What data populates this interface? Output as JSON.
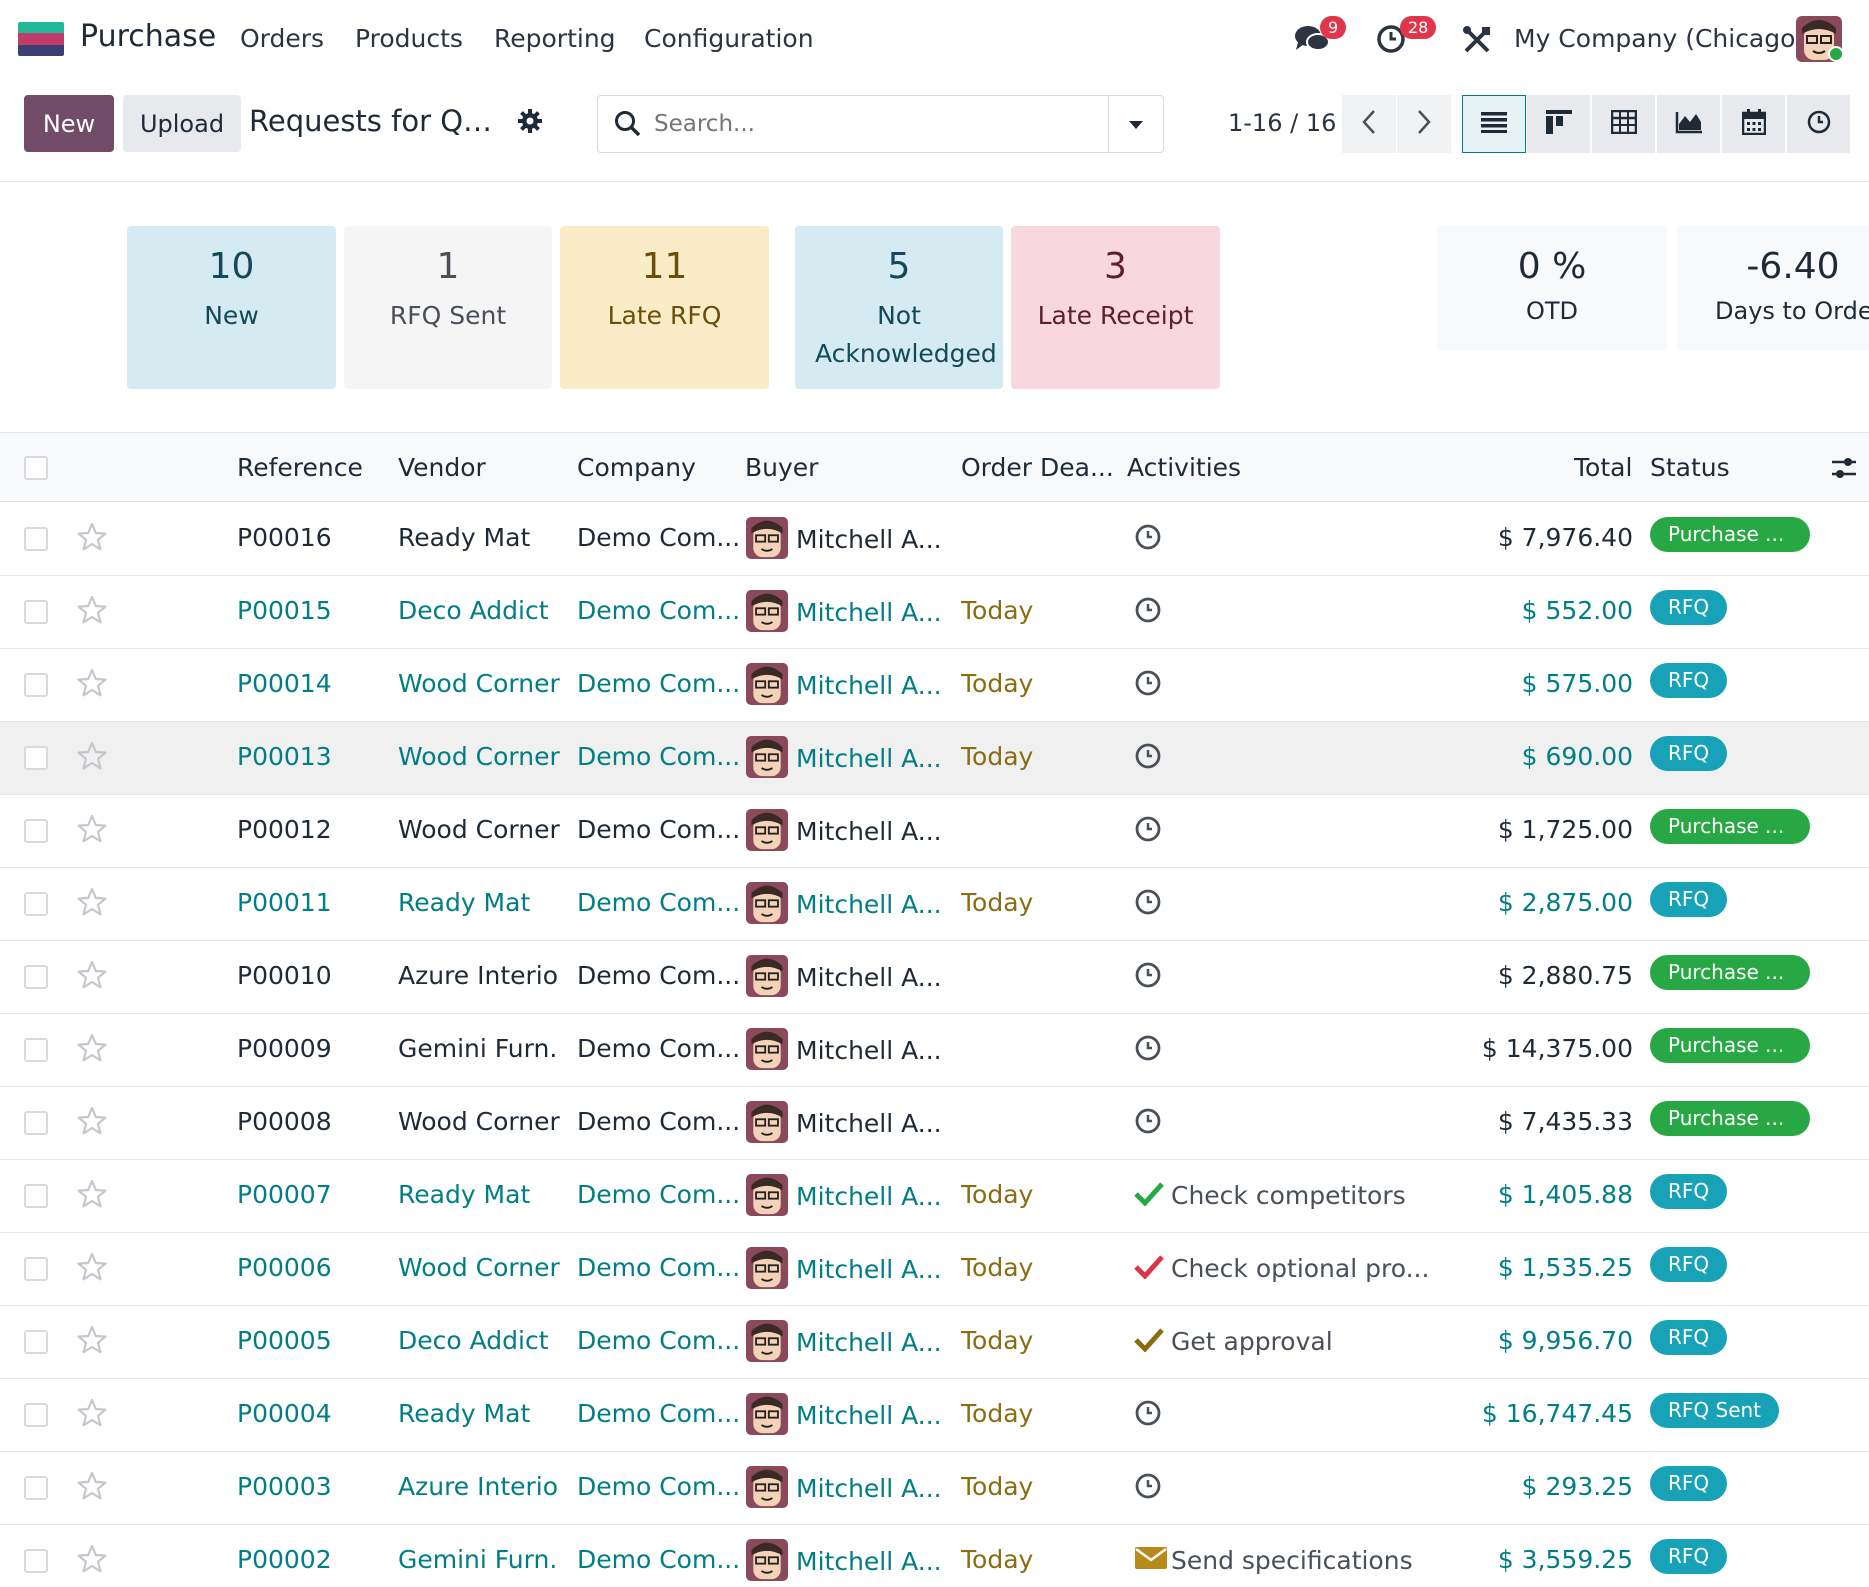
{
  "navbar": {
    "app_name": "Purchase",
    "menu": [
      "Orders",
      "Products",
      "Reporting",
      "Configuration"
    ],
    "messages_count": "9",
    "activities_count": "28",
    "company": "My Company (Chicago)"
  },
  "control": {
    "new_label": "New",
    "upload_label": "Upload",
    "breadcrumb": "Requests for Quotation",
    "search_placeholder": "Search...",
    "pager": "1-16 / 16"
  },
  "cards": [
    {
      "num": "10",
      "label": "New"
    },
    {
      "num": "1",
      "label": "RFQ Sent"
    },
    {
      "num": "11",
      "label": "Late RFQ"
    },
    {
      "num": "5",
      "label": "Not Acknowledged"
    },
    {
      "num": "3",
      "label": "Late Receipt"
    }
  ],
  "kpis": [
    {
      "num": "0 %",
      "label": "OTD"
    },
    {
      "num": "-6.40",
      "label": "Days to Order"
    }
  ],
  "table": {
    "headers": {
      "reference": "Reference",
      "vendor": "Vendor",
      "company": "Company",
      "buyer": "Buyer",
      "deadline": "Order Dea...",
      "activities": "Activities",
      "total": "Total",
      "status": "Status"
    },
    "rows": [
      {
        "ref": "P00016",
        "vendor": "Ready Mat",
        "company": "Demo Com...",
        "buyer": "Mitchell A...",
        "deadline": "",
        "activity": "",
        "activity_icon": "clock-icon",
        "total": "$ 7,976.40",
        "status": "Purchase ...",
        "status_kind": "purchase"
      },
      {
        "ref": "P00015",
        "vendor": "Deco Addict",
        "company": "Demo Com...",
        "buyer": "Mitchell A...",
        "deadline": "Today",
        "activity": "",
        "activity_icon": "clock-icon",
        "total": "$ 552.00",
        "status": "RFQ",
        "status_kind": "rfq"
      },
      {
        "ref": "P00014",
        "vendor": "Wood Corner",
        "company": "Demo Com...",
        "buyer": "Mitchell A...",
        "deadline": "Today",
        "activity": "",
        "activity_icon": "clock-icon",
        "total": "$ 575.00",
        "status": "RFQ",
        "status_kind": "rfq"
      },
      {
        "ref": "P00013",
        "vendor": "Wood Corner",
        "company": "Demo Com...",
        "buyer": "Mitchell A...",
        "deadline": "Today",
        "activity": "",
        "activity_icon": "clock-icon",
        "total": "$ 690.00",
        "status": "RFQ",
        "status_kind": "rfq"
      },
      {
        "ref": "P00012",
        "vendor": "Wood Corner",
        "company": "Demo Com...",
        "buyer": "Mitchell A...",
        "deadline": "",
        "activity": "",
        "activity_icon": "clock-icon",
        "total": "$ 1,725.00",
        "status": "Purchase ...",
        "status_kind": "purchase"
      },
      {
        "ref": "P00011",
        "vendor": "Ready Mat",
        "company": "Demo Com...",
        "buyer": "Mitchell A...",
        "deadline": "Today",
        "activity": "",
        "activity_icon": "clock-icon",
        "total": "$ 2,875.00",
        "status": "RFQ",
        "status_kind": "rfq"
      },
      {
        "ref": "P00010",
        "vendor": "Azure Interior",
        "company": "Demo Com...",
        "buyer": "Mitchell A...",
        "deadline": "",
        "activity": "",
        "activity_icon": "clock-icon",
        "total": "$ 2,880.75",
        "status": "Purchase ...",
        "status_kind": "purchase"
      },
      {
        "ref": "P00009",
        "vendor": "Gemini Furn...",
        "company": "Demo Com...",
        "buyer": "Mitchell A...",
        "deadline": "",
        "activity": "",
        "activity_icon": "clock-icon",
        "total": "$ 14,375.00",
        "status": "Purchase ...",
        "status_kind": "purchase"
      },
      {
        "ref": "P00008",
        "vendor": "Wood Corner",
        "company": "Demo Com...",
        "buyer": "Mitchell A...",
        "deadline": "",
        "activity": "",
        "activity_icon": "clock-icon",
        "total": "$ 7,435.33",
        "status": "Purchase ...",
        "status_kind": "purchase"
      },
      {
        "ref": "P00007",
        "vendor": "Ready Mat",
        "company": "Demo Com...",
        "buyer": "Mitchell A...",
        "deadline": "Today",
        "activity": "Check competitors",
        "activity_icon": "check-green-icon",
        "total": "$ 1,405.88",
        "status": "RFQ",
        "status_kind": "rfq"
      },
      {
        "ref": "P00006",
        "vendor": "Wood Corner",
        "company": "Demo Com...",
        "buyer": "Mitchell A...",
        "deadline": "Today",
        "activity": "Check optional pro...",
        "activity_icon": "check-red-icon",
        "total": "$ 1,535.25",
        "status": "RFQ",
        "status_kind": "rfq"
      },
      {
        "ref": "P00005",
        "vendor": "Deco Addict",
        "company": "Demo Com...",
        "buyer": "Mitchell A...",
        "deadline": "Today",
        "activity": "Get approval",
        "activity_icon": "check-amber-icon",
        "total": "$ 9,956.70",
        "status": "RFQ",
        "status_kind": "rfq"
      },
      {
        "ref": "P00004",
        "vendor": "Ready Mat",
        "company": "Demo Com...",
        "buyer": "Mitchell A...",
        "deadline": "Today",
        "activity": "",
        "activity_icon": "clock-icon",
        "total": "$ 16,747.45",
        "status": "RFQ Sent",
        "status_kind": "sent"
      },
      {
        "ref": "P00003",
        "vendor": "Azure Interior",
        "company": "Demo Com...",
        "buyer": "Mitchell A...",
        "deadline": "Today",
        "activity": "",
        "activity_icon": "clock-icon",
        "total": "$ 293.25",
        "status": "RFQ",
        "status_kind": "rfq"
      },
      {
        "ref": "P00002",
        "vendor": "Gemini Furn...",
        "company": "Demo Com...",
        "buyer": "Mitchell A...",
        "deadline": "Today",
        "activity": "Send specifications",
        "activity_icon": "envelope-icon",
        "total": "$ 3,559.25",
        "status": "RFQ",
        "status_kind": "rfq"
      }
    ]
  },
  "colors": {
    "brand": "#714b67",
    "link": "#017e84",
    "today": "#8a6d12",
    "purchase_badge": "#28a745",
    "rfq_badge": "#17a2b8",
    "card_new": "#d4ebf2",
    "card_sent": "#f5f5f5",
    "card_late": "#fbecc8",
    "card_notack": "#d4ebf2",
    "card_receipt": "#f8d7df"
  }
}
